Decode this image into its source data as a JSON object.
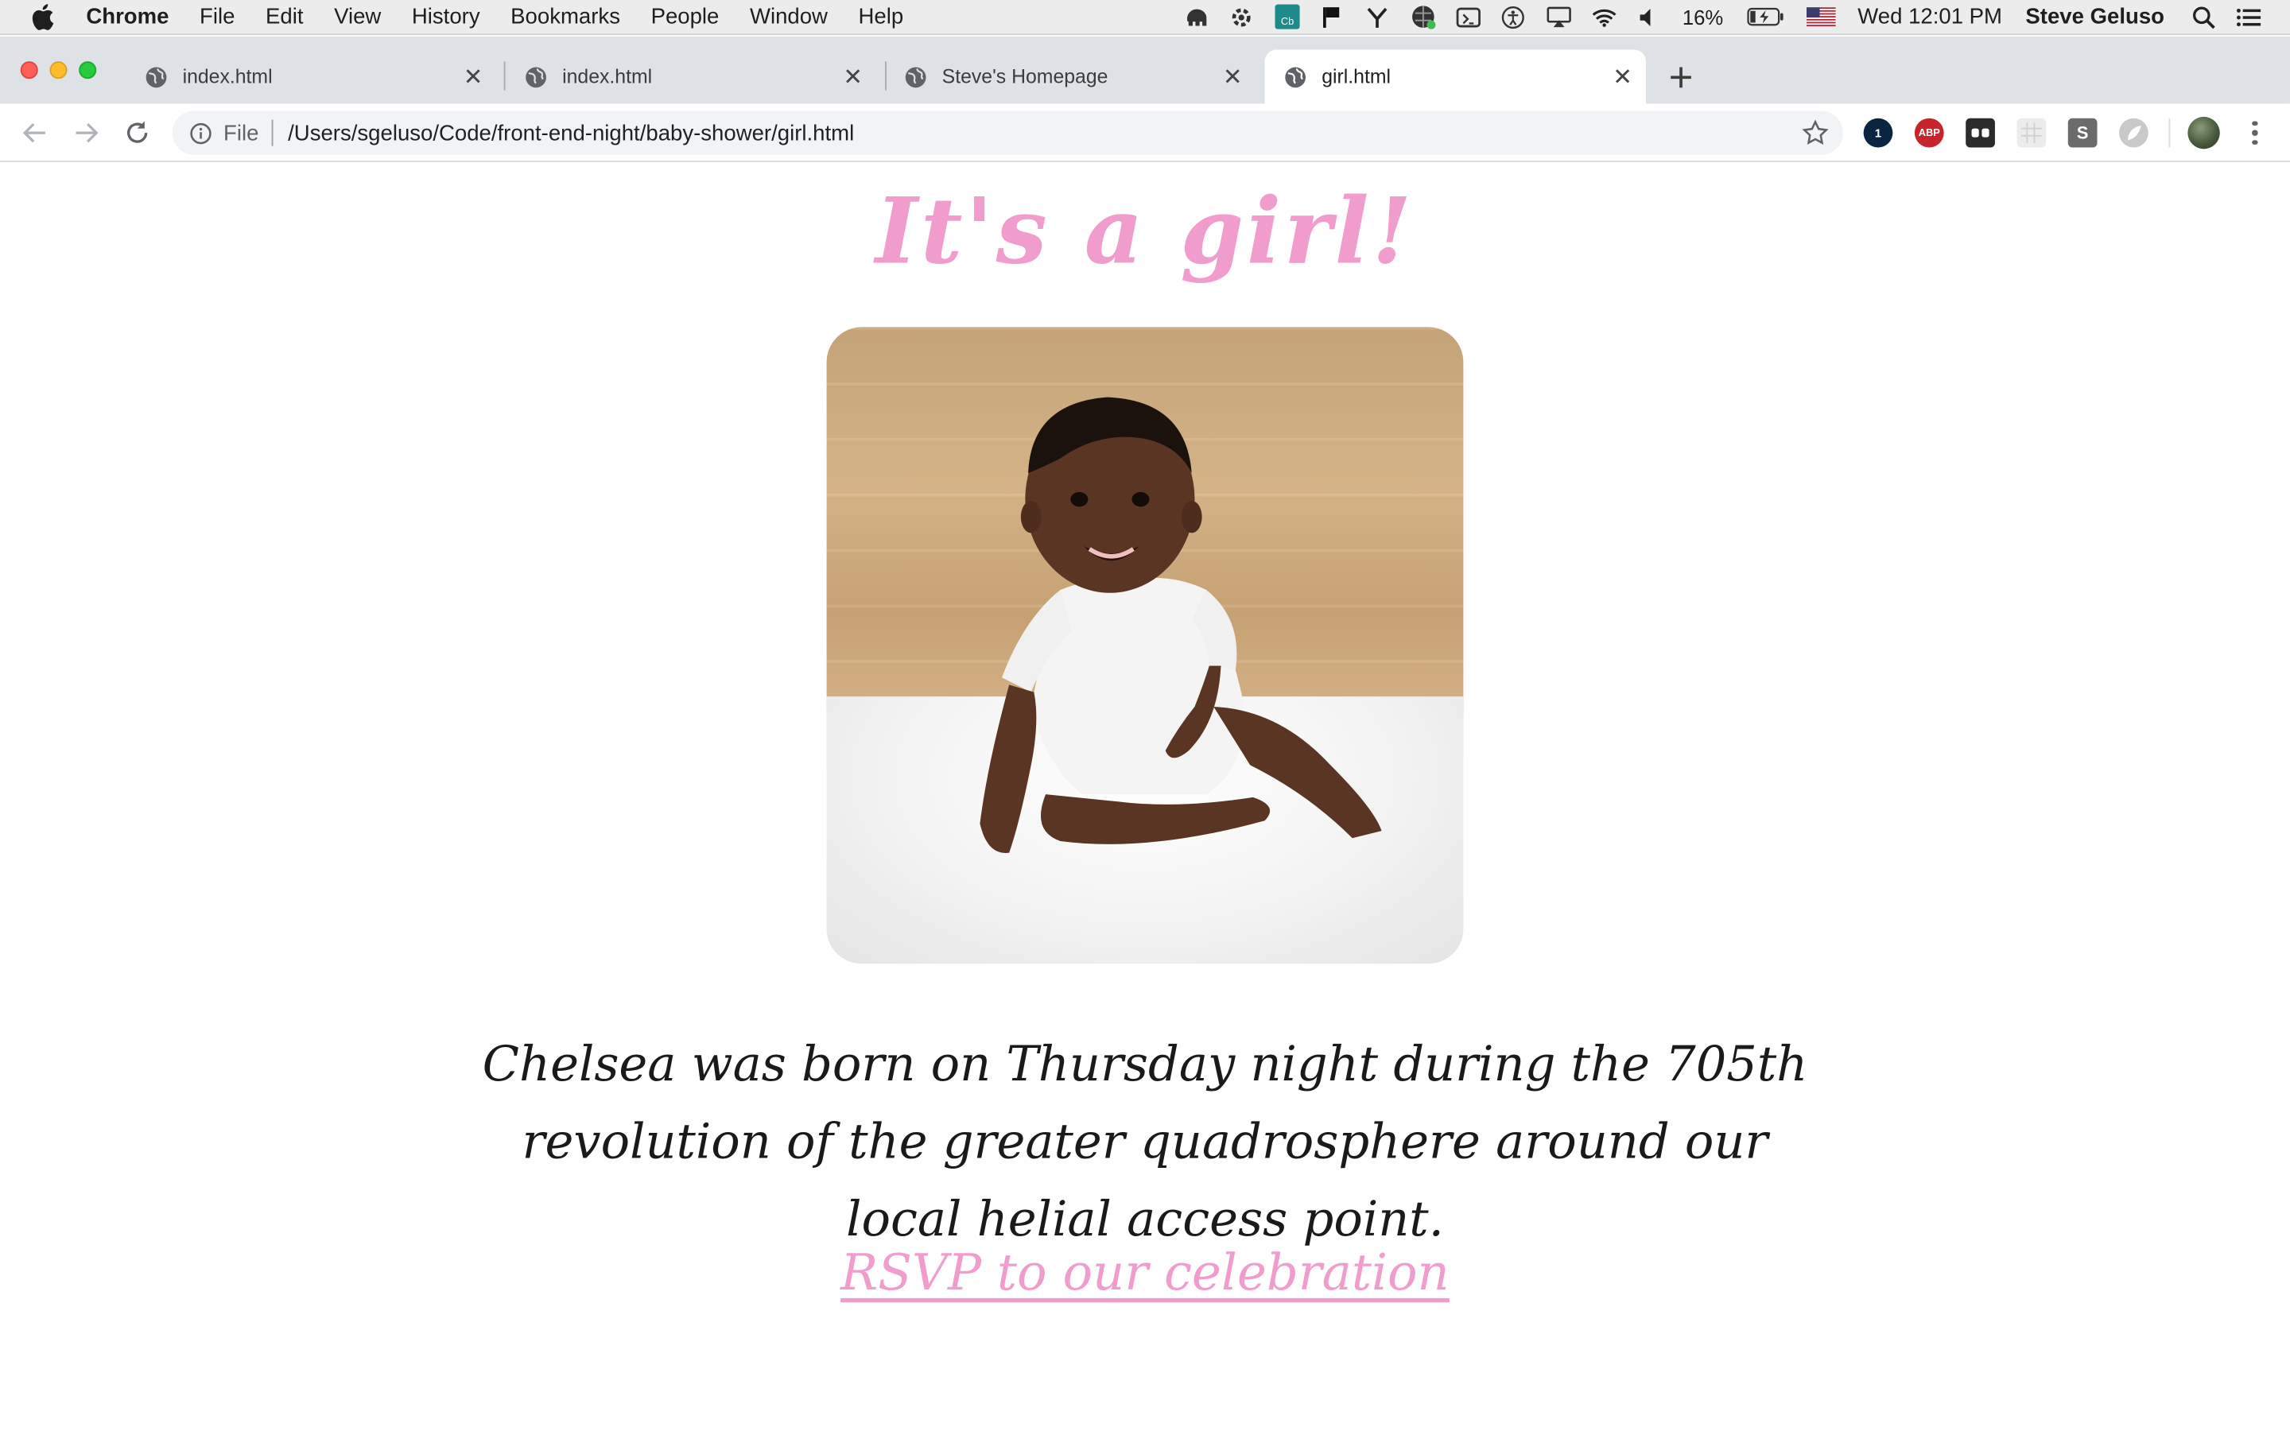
{
  "menubar": {
    "app_name": "Chrome",
    "items": [
      "File",
      "Edit",
      "View",
      "History",
      "Bookmarks",
      "People",
      "Window",
      "Help"
    ],
    "battery": "16%",
    "clock": "Wed 12:01 PM",
    "user": "Steve Geluso"
  },
  "tabs": [
    {
      "title": "index.html",
      "active": false
    },
    {
      "title": "index.html",
      "active": false
    },
    {
      "title": "Steve's Homepage",
      "active": false
    },
    {
      "title": "girl.html",
      "active": true
    }
  ],
  "omnibox": {
    "scheme": "File",
    "url": "/Users/sgeluso/Code/front-end-night/baby-shower/girl.html"
  },
  "extensions": [
    {
      "name": "1password-icon",
      "label": "1",
      "color": "#0a2540"
    },
    {
      "name": "adblock-icon",
      "label": "ABP",
      "color": "#c7252b"
    },
    {
      "name": "tabs-extension-icon",
      "label": "",
      "color": "#2b2b2b"
    },
    {
      "name": "grid-extension-icon",
      "label": "",
      "color": "#e6e6e6"
    },
    {
      "name": "s-extension-icon",
      "label": "S",
      "color": "#6b6b6b"
    },
    {
      "name": "leaf-extension-icon",
      "label": "",
      "color": "#b5b5b5"
    }
  ],
  "page": {
    "headline": "It's a girl!",
    "photo_alt": "baby sitting on a white rug",
    "description": "Chelsea was born on Thursday night during the 705th revolution of the greater quadrosphere around our local helial access point.",
    "rsvp_link": "RSVP to our celebration"
  },
  "colors": {
    "accent_pink": "#f09ccc",
    "tab_strip": "#dee1e6",
    "omnibox_bg": "#f1f3f4"
  }
}
